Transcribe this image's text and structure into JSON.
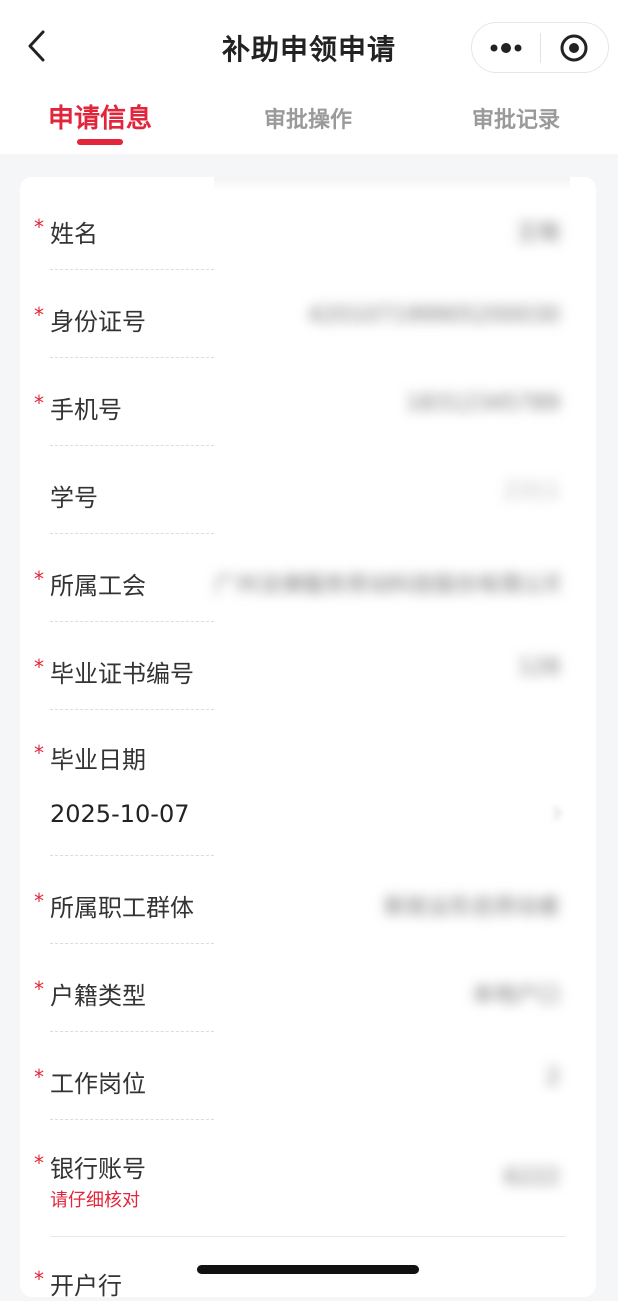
{
  "header": {
    "title": "补助申领申请",
    "back_icon": "chevron-left-icon",
    "more_icon": "more-dots-icon",
    "close_icon": "target-circle-icon"
  },
  "tabs": [
    {
      "label": "申请信息",
      "active": true
    },
    {
      "label": "审批操作",
      "active": false
    },
    {
      "label": "审批记录",
      "active": false
    }
  ],
  "form": {
    "required_mark": "*",
    "fields": [
      {
        "label": "姓名",
        "required": true,
        "value": "王晓"
      },
      {
        "label": "身份证号",
        "required": true,
        "value": "420107199905200030"
      },
      {
        "label": "手机号",
        "required": true,
        "value": "18312345789"
      },
      {
        "label": "学号",
        "required": false,
        "value": "2311"
      },
      {
        "label": "所属工会",
        "required": true,
        "value": "广州法律服务劳动科技股份有限公司工会..."
      },
      {
        "label": "毕业证书编号",
        "required": true,
        "value": "128"
      },
      {
        "label": "毕业日期",
        "required": true,
        "value": "2025-10-07"
      },
      {
        "label": "所属职工群体",
        "required": true,
        "value": "新就业形态劳动者"
      },
      {
        "label": "户籍类型",
        "required": true,
        "value": "本地户口"
      },
      {
        "label": "工作岗位",
        "required": true,
        "value": "2"
      },
      {
        "label": "银行账号",
        "required": true,
        "value": "6222",
        "hint": "请仔细核对"
      },
      {
        "label": "开户行",
        "required": true,
        "value": ""
      }
    ]
  },
  "colors": {
    "accent": "#e2253a",
    "background": "#f5f6f8",
    "card": "#ffffff"
  }
}
